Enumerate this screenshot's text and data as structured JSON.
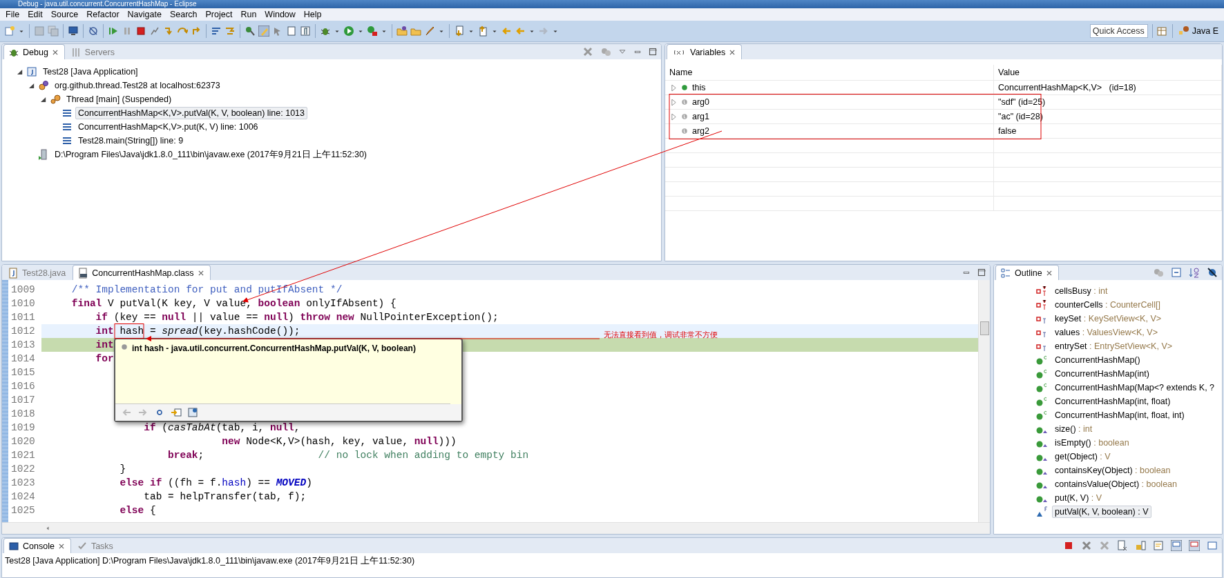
{
  "window": {
    "title": "Debug - java.util.concurrent.ConcurrentHashMap - Eclipse"
  },
  "menu": [
    "File",
    "Edit",
    "Source",
    "Refactor",
    "Navigate",
    "Search",
    "Project",
    "Run",
    "Window",
    "Help"
  ],
  "toolbar": {
    "quick_access": {
      "placeholder": "Quick Access"
    },
    "perspective": "Java E"
  },
  "debug_view": {
    "tabs": [
      {
        "label": "Debug",
        "selected": true
      },
      {
        "label": "Servers",
        "selected": false
      }
    ],
    "tree": [
      {
        "label": "Test28 [Java Application]",
        "kind": "app",
        "expanded": true,
        "selected": false,
        "children": [
          {
            "label": "org.github.thread.Test28 at localhost:62373",
            "kind": "vm",
            "expanded": true,
            "selected": false,
            "children": [
              {
                "label": "Thread [main] (Suspended)",
                "kind": "thread",
                "expanded": true,
                "selected": false,
                "children": [
                  {
                    "label": "ConcurrentHashMap<K,V>.putVal(K, V, boolean) line: 1013",
                    "kind": "frame",
                    "selected": true
                  },
                  {
                    "label": "ConcurrentHashMap<K,V>.put(K, V) line: 1006",
                    "kind": "frame",
                    "selected": false
                  },
                  {
                    "label": "Test28.main(String[]) line: 9",
                    "kind": "frame",
                    "selected": false
                  }
                ]
              }
            ]
          },
          {
            "label": "D:\\Program Files\\Java\\jdk1.8.0_111\\bin\\javaw.exe (2017年9月21日 上午11:52:30)",
            "kind": "process",
            "selected": false
          }
        ]
      }
    ]
  },
  "variables_view": {
    "tab": {
      "label": "Variables",
      "selected": true
    },
    "columns": [
      "Name",
      "Value"
    ],
    "rows": [
      {
        "name": "this",
        "value": "ConcurrentHashMap<K,V>   (id=18)",
        "expandable": true,
        "kind": "field"
      },
      {
        "name": "arg0",
        "value": "\"sdf\" (id=25)",
        "expandable": true,
        "kind": "local"
      },
      {
        "name": "arg1",
        "value": "\"ac\" (id=28)",
        "expandable": true,
        "kind": "local"
      },
      {
        "name": "arg2",
        "value": "false",
        "expandable": false,
        "kind": "local"
      }
    ]
  },
  "editor": {
    "tabs": [
      {
        "label": "Test28.java",
        "kind": "java",
        "selected": false
      },
      {
        "label": "ConcurrentHashMap.class",
        "kind": "class",
        "selected": true
      }
    ],
    "lines": [
      {
        "number": "1009",
        "current": false,
        "instruction": false,
        "segments": [
          {
            "text": "    /** Implementation for put and putIfAbsent */",
            "kind": "javadoc"
          }
        ]
      },
      {
        "number": "1010",
        "current": false,
        "instruction": false,
        "segments": [
          {
            "text": "    final",
            "kind": "keyword"
          },
          {
            "text": " V putVal(K key, V value, ",
            "kind": "plain"
          },
          {
            "text": "boolean",
            "kind": "keyword"
          },
          {
            "text": " onlyIfAbsent) {",
            "kind": "plain"
          }
        ]
      },
      {
        "number": "1011",
        "current": false,
        "instruction": false,
        "segments": [
          {
            "text": "        if",
            "kind": "keyword"
          },
          {
            "text": " (key == ",
            "kind": "plain"
          },
          {
            "text": "null",
            "kind": "keyword"
          },
          {
            "text": " || value == ",
            "kind": "plain"
          },
          {
            "text": "null",
            "kind": "keyword"
          },
          {
            "text": ") ",
            "kind": "plain"
          },
          {
            "text": "throw new",
            "kind": "keyword"
          },
          {
            "text": " NullPointerException();",
            "kind": "plain"
          }
        ]
      },
      {
        "number": "1012",
        "current": true,
        "instruction": false,
        "segments": [
          {
            "text": "        int",
            "kind": "keyword"
          },
          {
            "text": " hash = ",
            "kind": "plain"
          },
          {
            "text": "spread",
            "kind": "static"
          },
          {
            "text": "(key.hashCode());",
            "kind": "plain"
          }
        ]
      },
      {
        "number": "1013",
        "current": false,
        "instruction": true,
        "segments": [
          {
            "text": "        int",
            "kind": "keyword"
          }
        ]
      },
      {
        "number": "1014",
        "current": false,
        "instruction": false,
        "segments": [
          {
            "text": "        for",
            "kind": "keyword"
          }
        ]
      },
      {
        "number": "1015",
        "current": false,
        "instruction": false
      },
      {
        "number": "1016",
        "current": false,
        "instruction": false
      },
      {
        "number": "1017",
        "current": false,
        "instruction": false
      },
      {
        "number": "1018",
        "current": false,
        "instruction": false
      },
      {
        "number": "1019",
        "current": false,
        "instruction": false,
        "segments": [
          {
            "text": "                if",
            "kind": "keyword"
          },
          {
            "text": " (",
            "kind": "plain"
          },
          {
            "text": "casTabAt",
            "kind": "static"
          },
          {
            "text": "(tab, i, ",
            "kind": "plain"
          },
          {
            "text": "null",
            "kind": "keyword"
          },
          {
            "text": ",",
            "kind": "plain"
          }
        ]
      },
      {
        "number": "1020",
        "current": false,
        "instruction": false,
        "segments": [
          {
            "text": "                             new",
            "kind": "keyword"
          },
          {
            "text": " Node<K,V>(hash, key, value, ",
            "kind": "plain"
          },
          {
            "text": "null",
            "kind": "keyword"
          },
          {
            "text": ")))",
            "kind": "plain"
          }
        ]
      },
      {
        "number": "1021",
        "current": false,
        "instruction": false,
        "segments": [
          {
            "text": "                    break",
            "kind": "keyword"
          },
          {
            "text": ";                   ",
            "kind": "plain"
          },
          {
            "text": "// no lock when adding to empty bin",
            "kind": "comment"
          }
        ]
      },
      {
        "number": "1022",
        "current": false,
        "instruction": false,
        "segments": [
          {
            "text": "            }",
            "kind": "plain"
          }
        ]
      },
      {
        "number": "1023",
        "current": false,
        "instruction": false,
        "segments": [
          {
            "text": "            else if",
            "kind": "keyword"
          },
          {
            "text": " ((fh = f.",
            "kind": "plain"
          },
          {
            "text": "hash",
            "kind": "field"
          },
          {
            "text": ") == ",
            "kind": "plain"
          },
          {
            "text": "MOVED",
            "kind": "constant"
          },
          {
            "text": ")",
            "kind": "plain"
          }
        ]
      },
      {
        "number": "1024",
        "current": false,
        "instruction": false,
        "segments": [
          {
            "text": "                tab = helpTransfer(tab, f);",
            "kind": "plain"
          }
        ]
      },
      {
        "number": "1025",
        "current": false,
        "instruction": false,
        "segments": [
          {
            "text": "            else",
            "kind": "keyword"
          },
          {
            "text": " {",
            "kind": "plain"
          }
        ]
      }
    ],
    "hover_popup": {
      "text": "int hash - java.util.concurrent.ConcurrentHashMap.putVal(K, V, boolean)"
    }
  },
  "outline_view": {
    "tab": {
      "label": "Outline",
      "selected": true
    },
    "items": [
      {
        "name": "cellsBusy",
        "type": ": int",
        "kind": "volatile",
        "selected": false
      },
      {
        "name": "counterCells",
        "type": ": CounterCell[]",
        "kind": "volatile",
        "selected": false
      },
      {
        "name": "keySet",
        "type": ": KeySetView<K, V>",
        "kind": "transient",
        "selected": false
      },
      {
        "name": "values",
        "type": ": ValuesView<K, V>",
        "kind": "transient",
        "selected": false
      },
      {
        "name": "entrySet",
        "type": ": EntrySetView<K, V>",
        "kind": "transient",
        "selected": false
      },
      {
        "name": "ConcurrentHashMap()",
        "kind": "constructor",
        "selected": false
      },
      {
        "name": "ConcurrentHashMap(int)",
        "kind": "constructor",
        "selected": false
      },
      {
        "name": "ConcurrentHashMap(Map<? extends K, ?",
        "kind": "constructor",
        "selected": false
      },
      {
        "name": "ConcurrentHashMap(int, float)",
        "kind": "constructor",
        "selected": false
      },
      {
        "name": "ConcurrentHashMap(int, float, int)",
        "kind": "constructor",
        "selected": false
      },
      {
        "name": "size()",
        "type": ": int",
        "kind": "method",
        "selected": false
      },
      {
        "name": "isEmpty()",
        "type": ": boolean",
        "kind": "method",
        "selected": false
      },
      {
        "name": "get(Object)",
        "type": ": V",
        "kind": "method",
        "selected": false
      },
      {
        "name": "containsKey(Object)",
        "type": ": boolean",
        "kind": "method",
        "selected": false
      },
      {
        "name": "containsValue(Object)",
        "type": ": boolean",
        "kind": "method",
        "selected": false
      },
      {
        "name": "put(K, V)",
        "type": ": V",
        "kind": "method",
        "selected": false
      },
      {
        "name": "putVal(K, V, boolean)",
        "type": ": V",
        "kind": "final",
        "selected": true
      }
    ]
  },
  "console_view": {
    "tabs": [
      {
        "label": "Console",
        "selected": true
      },
      {
        "label": "Tasks",
        "selected": false
      }
    ],
    "line": "Test28 [Java Application] D:\\Program Files\\Java\\jdk1.8.0_111\\bin\\javaw.exe (2017年9月21日 上午11:52:30)"
  },
  "annotation": {
    "note": "无法直接看到值，调试非常不方便"
  }
}
